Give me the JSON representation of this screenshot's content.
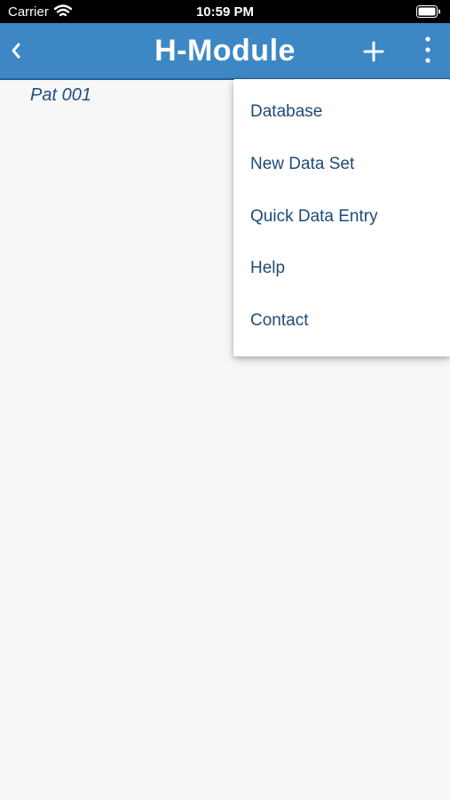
{
  "status_bar": {
    "carrier": "Carrier",
    "time": "10:59 PM"
  },
  "nav": {
    "title": "H-Module",
    "back_icon": "chevron-left-icon",
    "add_icon": "plus-icon",
    "more_icon": "more-vertical-icon"
  },
  "main": {
    "record_label": "Pat 001"
  },
  "menu": {
    "items": [
      {
        "label": "Database"
      },
      {
        "label": "New Data Set"
      },
      {
        "label": "Quick Data Entry"
      },
      {
        "label": "Help"
      },
      {
        "label": "Contact"
      }
    ]
  },
  "colors": {
    "nav_background": "#3d88c4",
    "menu_text": "#1f4a78",
    "page_background": "#f7f7f8"
  }
}
